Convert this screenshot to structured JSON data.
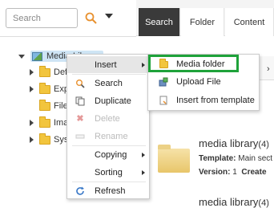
{
  "search": {
    "placeholder": "Search"
  },
  "tabs": [
    {
      "label": "Search",
      "active": true
    },
    {
      "label": "Folder",
      "active": false
    },
    {
      "label": "Content",
      "active": false
    }
  ],
  "tree": {
    "root": {
      "label": "Media Library",
      "expanded": true
    },
    "children": [
      {
        "label": "Def",
        "expandable": true
      },
      {
        "label": "Exp",
        "expandable": true
      },
      {
        "label": "File",
        "expandable": false
      },
      {
        "label": "Ima",
        "expandable": true
      },
      {
        "label": "Syst",
        "expandable": true
      }
    ]
  },
  "context_menu": {
    "items": [
      {
        "label": "Insert",
        "icon": "none",
        "has_submenu": true,
        "active": true,
        "disabled": false
      },
      {
        "label": "Search",
        "icon": "search-icon",
        "has_submenu": false,
        "active": false,
        "disabled": false
      },
      {
        "label": "Duplicate",
        "icon": "duplicate-icon",
        "has_submenu": false,
        "active": false,
        "disabled": false
      },
      {
        "label": "Delete",
        "icon": "delete-icon",
        "has_submenu": false,
        "active": false,
        "disabled": true
      },
      {
        "label": "Rename",
        "icon": "rename-icon",
        "has_submenu": false,
        "active": false,
        "disabled": true
      },
      {
        "label": "Copying",
        "icon": "none",
        "has_submenu": true,
        "active": false,
        "disabled": false
      },
      {
        "label": "Sorting",
        "icon": "none",
        "has_submenu": true,
        "active": false,
        "disabled": false
      },
      {
        "label": "Refresh",
        "icon": "refresh-icon",
        "has_submenu": false,
        "active": false,
        "disabled": false
      }
    ]
  },
  "insert_submenu": {
    "items": [
      {
        "label": "Media folder",
        "icon": "folder-icon",
        "highlighted": true
      },
      {
        "label": "Upload File",
        "icon": "upload-icon",
        "highlighted": false
      },
      {
        "label": "Insert from template",
        "icon": "template-icon",
        "highlighted": false
      }
    ]
  },
  "content": {
    "item_title": "media library",
    "item_count": "(4)",
    "template_label": "Template:",
    "template_value": "Main sect",
    "version_label": "Version:",
    "version_value": "1",
    "created_label": "Create",
    "item2_title": "media library",
    "item2_count": "(4)"
  },
  "colors": {
    "highlight_border": "#1fa23a",
    "active_tab": "#3a3a3a",
    "tree_selected": "#cfe5f5"
  }
}
